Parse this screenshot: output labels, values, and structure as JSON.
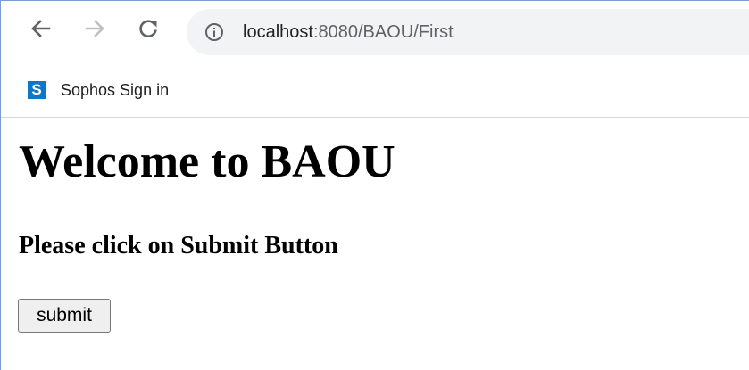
{
  "browser": {
    "url_host": "localhost",
    "url_path": ":8080/BAOU/First"
  },
  "bookmarks": [
    {
      "label": "Sophos Sign in",
      "icon": "sophos-icon",
      "icon_letter": "S"
    }
  ],
  "page": {
    "title": "Welcome to BAOU",
    "subtitle": "Please click on Submit Button",
    "submit_label": "submit"
  },
  "colors": {
    "sophos_blue": "#0e78c8",
    "omnibox_bg": "#f1f3f4"
  }
}
